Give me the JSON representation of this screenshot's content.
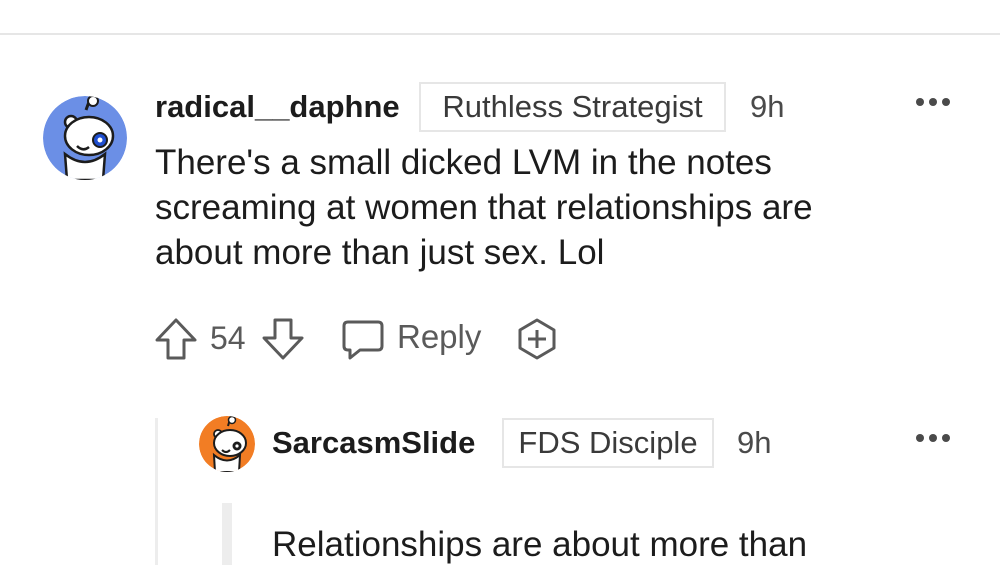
{
  "comment": {
    "username": "radical__daphne",
    "flair": "Ruthless Strategist",
    "time": "9h",
    "body_lines": [
      "There's a small dicked LVM in the notes",
      "screaming at women that relationships are",
      "about more than just sex. Lol"
    ],
    "upvotes": "54",
    "reply_label": "Reply",
    "avatar_color": "#6b8fe6"
  },
  "reply": {
    "username": "SarcasmSlide",
    "flair": "FDS Disciple",
    "time": "9h",
    "body_lines": [
      "Relationships are about more than"
    ],
    "avatar_color": "#f27d24"
  },
  "icons": {
    "more": "more-horizontal-icon",
    "upvote": "upvote-arrow-icon",
    "downvote": "downvote-arrow-icon",
    "reply": "speech-bubble-icon",
    "award": "plus-award-icon"
  }
}
